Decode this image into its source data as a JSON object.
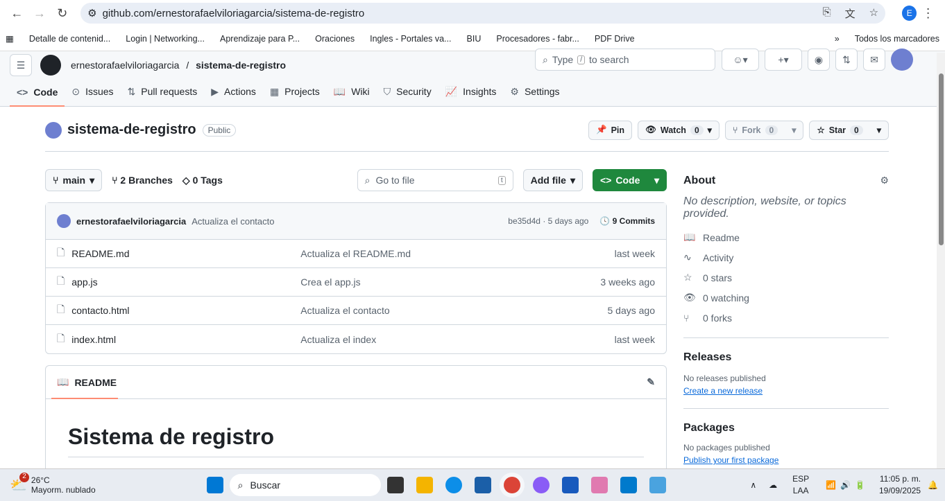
{
  "browser": {
    "url": "github.com/ernestorafaelviloriagarcia/sistema-de-registro",
    "profile": "E",
    "bookmarks": [
      "Detalle de contenid...",
      "Login | Networking...",
      "Aprendizaje para P...",
      "Oraciones",
      "Ingles - Portales va...",
      "BIU",
      "Procesadores - fabr...",
      "PDF Drive",
      "Todos los marcadores"
    ]
  },
  "header": {
    "owner": "ernestorafaelviloriagarcia",
    "sep": "/",
    "repo": "sistema-de-registro",
    "search_a": "Type",
    "search_key": "/",
    "search_b": "to search"
  },
  "tabs": [
    {
      "label": "Code",
      "icon": "code-icon"
    },
    {
      "label": "Issues",
      "icon": "issue-icon"
    },
    {
      "label": "Pull requests",
      "icon": "pull-request-icon"
    },
    {
      "label": "Actions",
      "icon": "play-icon"
    },
    {
      "label": "Projects",
      "icon": "table-icon"
    },
    {
      "label": "Wiki",
      "icon": "book-icon"
    },
    {
      "label": "Security",
      "icon": "shield-icon"
    },
    {
      "label": "Insights",
      "icon": "graph-icon"
    },
    {
      "label": "Settings",
      "icon": "gear-icon"
    }
  ],
  "repo": {
    "name": "sistema-de-registro",
    "visibility": "Public",
    "pin": "Pin",
    "watch": "Watch",
    "watch_count": "0",
    "fork": "Fork",
    "fork_count": "0",
    "star": "Star",
    "star_count": "0"
  },
  "bar": {
    "branch": "main",
    "branches": "2 Branches",
    "tags": "0 Tags",
    "goto": "Go to file",
    "goto_key": "t",
    "add_file": "Add file",
    "code": "Code"
  },
  "commit": {
    "author": "ernestorafaelviloriagarcia",
    "message": "Actualiza el contacto",
    "meta": "be35d4d · 5 days ago",
    "commits": "9 Commits"
  },
  "files": [
    {
      "name": "README.md",
      "msg": "Actualiza el README.md",
      "date": "last week"
    },
    {
      "name": "app.js",
      "msg": "Crea el app.js",
      "date": "3 weeks ago"
    },
    {
      "name": "contacto.html",
      "msg": "Actualiza el contacto",
      "date": "5 days ago"
    },
    {
      "name": "index.html",
      "msg": "Actualiza el index",
      "date": "last week"
    }
  ],
  "readme": {
    "tab": "README",
    "title": "Sistema de registro"
  },
  "about": {
    "title": "About",
    "desc": "No description, website, or topics provided.",
    "items": [
      "Readme",
      "Activity",
      "0 stars",
      "0 watching",
      "0 forks"
    ],
    "releases": "Releases",
    "no_releases": "No releases published",
    "create_release": "Create a new release",
    "packages": "Packages",
    "no_packages": "No packages published",
    "publish_pkg": "Publish your first package"
  },
  "taskbar": {
    "temp": "26°C",
    "weather": "Mayorm. nublado",
    "badge": "2",
    "search": "Buscar",
    "lang1": "ESP",
    "lang2": "LAA",
    "time": "11:05 p. m.",
    "date": "19/09/2025"
  }
}
